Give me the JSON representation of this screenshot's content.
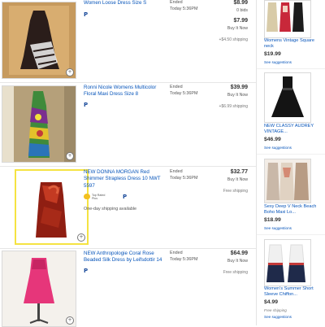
{
  "listings": [
    {
      "title": "Women Loose Dress Size S",
      "status": "Ended",
      "time": "Today 5:36PM",
      "price1": "$8.99",
      "sub1": "0 bids",
      "price2": "$7.99",
      "sub2": "Buy It Now",
      "shipping": "+$4.50 shipping"
    },
    {
      "title": "Ronni Nicole Womens Multicolor Floral Maxi Dress Size 8",
      "status": "Ended",
      "time": "Today 5:36PM",
      "price": "$39.99",
      "sub": "Buy It Now",
      "shipping": "+$6.99 shipping"
    },
    {
      "title": "NEW DONNA MORGAN Red Shimmer Strapless Dress 10 NWT 5597",
      "status": "Ended",
      "time": "Today 5:36PM",
      "price": "$32.77",
      "sub": "Buy It Now",
      "shipping": "Free shipping",
      "badge": "Top Rated Plus",
      "oneday": "One-day shipping available"
    },
    {
      "title": "NEW Anthropologie Coral Rose Beaded Silk Dress by Leifsdottir 14",
      "status": "Ended",
      "time": "Today 5:36PM",
      "price": "$64.99",
      "sub": "Buy It Now",
      "shipping": "Free shipping"
    }
  ],
  "sidebar": [
    {
      "title": "Womens Vintage Square neck",
      "price": "$19.99",
      "shipping": "",
      "link": "See suggestions"
    },
    {
      "title": "NEW CLASSY AUDREY VINTAGE...",
      "price": "$46.99",
      "shipping": "",
      "link": "See suggestions"
    },
    {
      "title": "Sexy Deep V Neck Beach Boho Maxi Lo...",
      "price": "$18.99",
      "shipping": "",
      "link": "See suggestions"
    },
    {
      "title": "Women's Summer Short Sleeve Chiffon...",
      "price": "$4.99",
      "shipping": "Free shipping",
      "link": "See suggestions"
    }
  ],
  "paypal_glyph": "P",
  "zoom_glyph": "+",
  "colors": {
    "link": "#0654ba",
    "featured_border": "#f5e342"
  }
}
